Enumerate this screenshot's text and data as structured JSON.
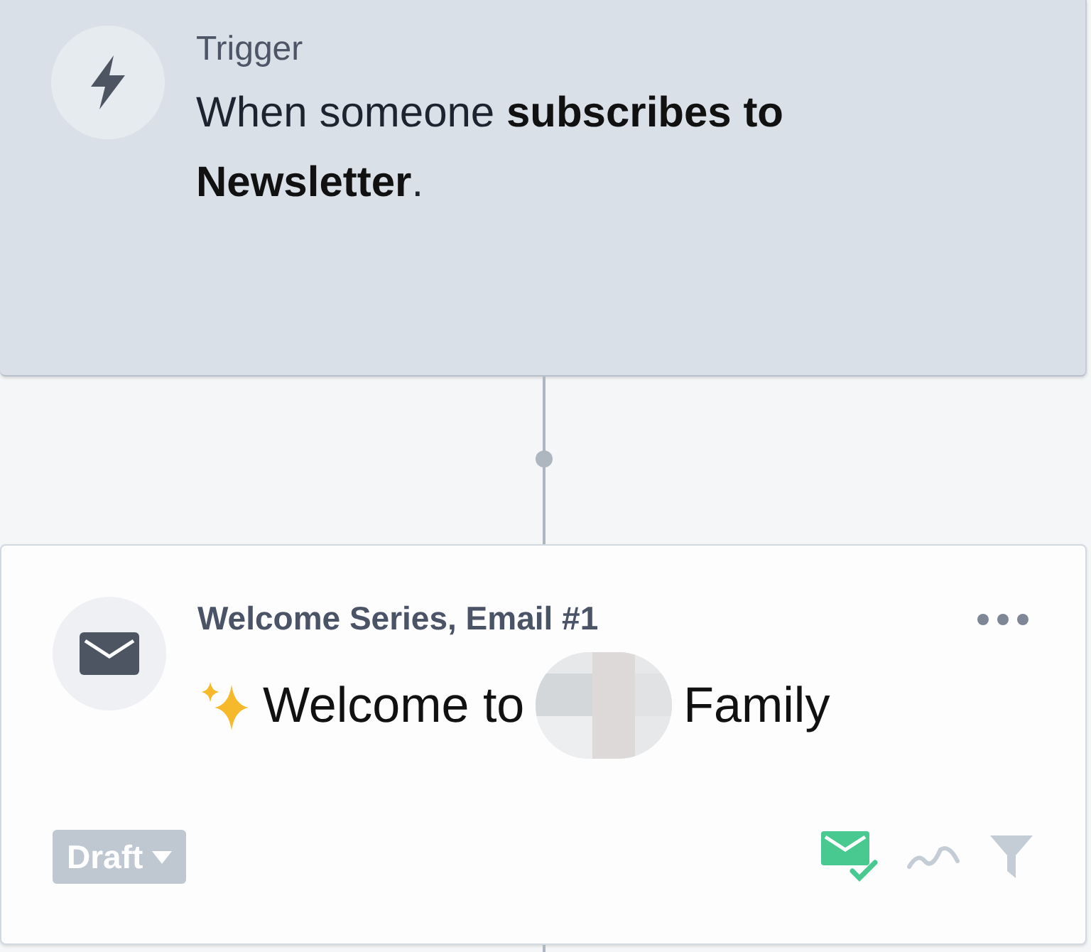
{
  "trigger": {
    "label": "Trigger",
    "sentence": "When someone **subscribes to Newsletter**."
  },
  "email": {
    "series": "Welcome Series, Email #1",
    "title_before": "Welcome to",
    "title_after": "Family",
    "status": "Draft",
    "status_icons": [
      {
        "kind": "mail-check",
        "active": true
      },
      {
        "kind": "analytics",
        "active": false
      },
      {
        "kind": "filter",
        "active": false
      }
    ]
  }
}
